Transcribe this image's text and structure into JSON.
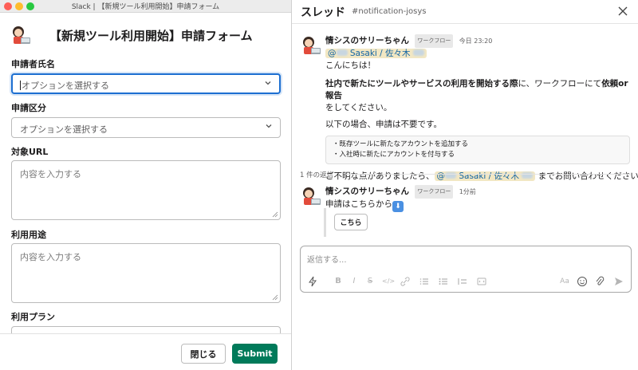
{
  "window": {
    "title": "Slack | 【新規ツール利用開始】申請フォーム"
  },
  "modal": {
    "title": "【新規ツール利用開始】申請フォーム",
    "fields": [
      {
        "label": "申請者氏名",
        "kind": "select",
        "placeholder": "オプションを選択する"
      },
      {
        "label": "申請区分",
        "kind": "select",
        "placeholder": "オプションを選択する"
      },
      {
        "label": "対象URL",
        "kind": "textarea",
        "placeholder": "内容を入力する"
      },
      {
        "label": "利用用途",
        "kind": "textarea",
        "placeholder": "内容を入力する"
      },
      {
        "label": "利用プラン",
        "kind": "textarea",
        "placeholder": ""
      }
    ],
    "close_label": "閉じる",
    "submit_label": "Submit"
  },
  "thread": {
    "title": "スレッド",
    "channel": "#notification-josys",
    "messages": [
      {
        "sender": "情シスのサリーちゃん",
        "badge": "ワークフロー",
        "time": "今日 23:20",
        "mention": "@",
        "mention_name": "Sasaki / 佐々木",
        "greeting": "こんにちは！",
        "line1_bold1": "社内で新たにツールやサービスの利用を開始する際",
        "line1_mid": "に、ワークフローにて",
        "line1_bold2": "依頼or報告",
        "line1_end": "をしてください。",
        "line2": "以下の場合、申請は不要です。",
        "quote": [
          "・既存ツールに新たなアカウントを追加する",
          "・入社時に新たにアカウントを付与する"
        ],
        "closing_pre": "ご不明な点がありましたら、",
        "closing_mention_at": "@",
        "closing_mention_name": "Sasaki / 佐々木",
        "closing_post": "までお問い合わせください！"
      },
      {
        "sender": "情シスのサリーちゃん",
        "badge": "ワークフロー",
        "time": "1分前",
        "text": "申請はこちらから",
        "emoji": "⬇",
        "button_label": "こちら"
      }
    ],
    "replies_label": "1 件の返信",
    "composer_placeholder": "返信する..."
  }
}
